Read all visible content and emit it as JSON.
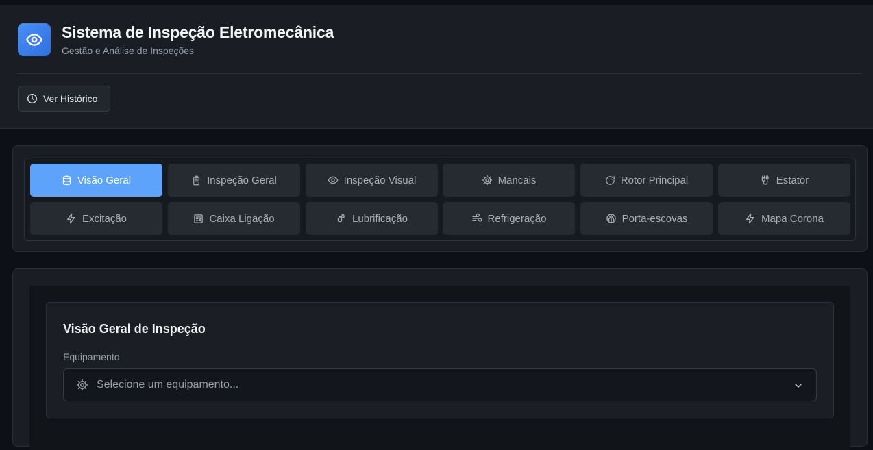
{
  "header": {
    "title": "Sistema de Inspeção Eletromecânica",
    "subtitle": "Gestão e Análise de Inspeções",
    "logo_icon": "eye-icon",
    "history_button": {
      "label": "Ver Histórico",
      "icon": "clock-icon"
    }
  },
  "tabs": [
    {
      "label": "Visão Geral",
      "icon": "database-icon",
      "active": true
    },
    {
      "label": "Inspeção Geral",
      "icon": "clipboard-icon",
      "active": false
    },
    {
      "label": "Inspeção Visual",
      "icon": "eye-icon",
      "active": false
    },
    {
      "label": "Mancais",
      "icon": "gear-icon",
      "active": false
    },
    {
      "label": "Rotor Principal",
      "icon": "rotate-icon",
      "active": false
    },
    {
      "label": "Estator",
      "icon": "cable-icon",
      "active": false
    },
    {
      "label": "Excitação",
      "icon": "zap-icon",
      "active": false
    },
    {
      "label": "Caixa Ligação",
      "icon": "box-icon",
      "active": false
    },
    {
      "label": "Lubrificação",
      "icon": "droplets-icon",
      "active": false
    },
    {
      "label": "Refrigeração",
      "icon": "wind-icon",
      "active": false
    },
    {
      "label": "Porta-escovas",
      "icon": "brain-icon",
      "active": false
    },
    {
      "label": "Mapa Corona",
      "icon": "zap-icon",
      "active": false
    }
  ],
  "overview": {
    "title": "Visão Geral de Inspeção",
    "equipment_label": "Equipamento",
    "equipment_placeholder": "Selecione um equipamento...",
    "equipment_icon": "gear-icon"
  },
  "colors": {
    "accent": "#5ea3fb",
    "logo_gradient_start": "#4a8ff5",
    "logo_gradient_end": "#2f6fe0",
    "background": "#0d1117",
    "card": "#1a1d23"
  }
}
